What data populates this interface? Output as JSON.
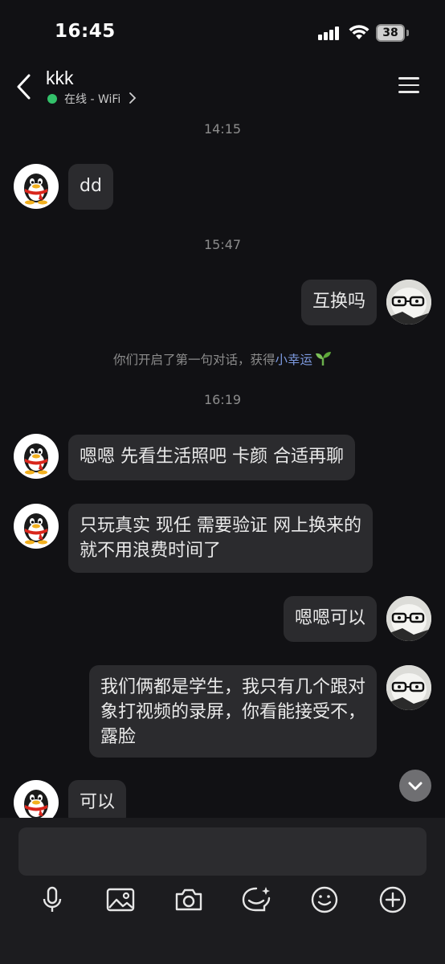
{
  "status_bar": {
    "time": "16:45",
    "battery": "38"
  },
  "header": {
    "contact_name": "kkk",
    "status": "在线 - WiFi"
  },
  "timestamps": [
    "14:15",
    "15:47",
    "16:19"
  ],
  "system_notice": {
    "text": "你们开启了第一句对话，获得",
    "highlight": "小幸运"
  },
  "messages": [
    {
      "side": "peer",
      "text": "dd"
    },
    {
      "side": "me",
      "text": "互换吗"
    },
    {
      "side": "peer",
      "text": "嗯嗯 先看生活照吧 卡颜 合适再聊"
    },
    {
      "side": "peer",
      "text": "只玩真实 现任 需要验证 网上换来的\n就不用浪费时间了"
    },
    {
      "side": "me",
      "text": "嗯嗯可以"
    },
    {
      "side": "me",
      "text": "我们俩都是学生，我只有几个跟对\n象打视频的录屏，你看能接受不，\n露脸"
    },
    {
      "side": "peer",
      "text": "可以"
    }
  ],
  "toolbar": [
    "microphone-icon",
    "image-icon",
    "camera-icon",
    "emoji-bubble-icon",
    "smiley-icon",
    "plus-icon"
  ],
  "colors": {
    "background": "#111114",
    "bubble": "#2b2b2e",
    "online": "#33c16a",
    "highlight": "#7d9ae0"
  }
}
